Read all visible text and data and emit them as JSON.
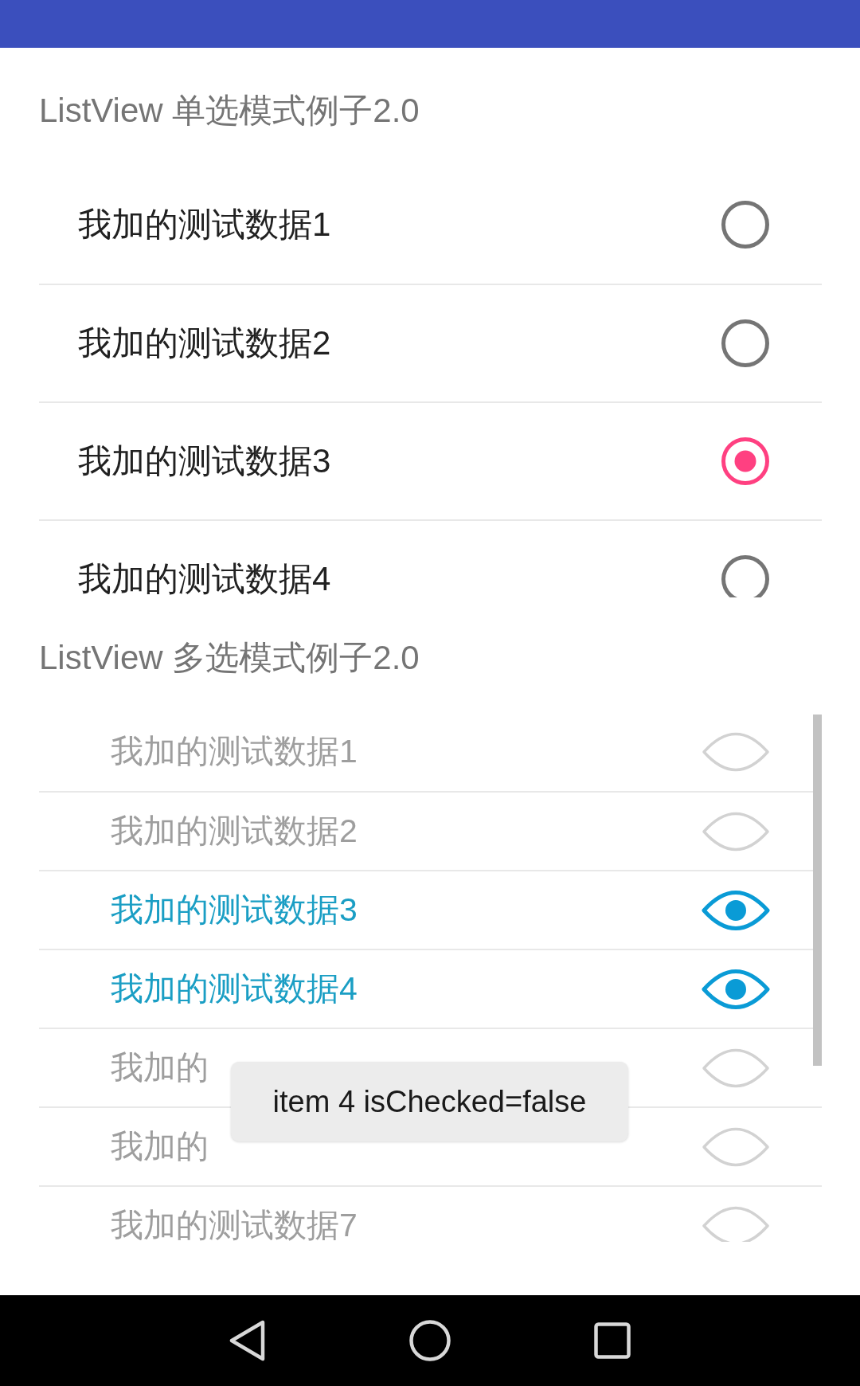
{
  "single_choice": {
    "title": "ListView 单选模式例子2.0",
    "items": [
      {
        "label": "我加的测试数据1",
        "selected": false
      },
      {
        "label": "我加的测试数据2",
        "selected": false
      },
      {
        "label": "我加的测试数据3",
        "selected": true
      },
      {
        "label": "我加的测试数据4",
        "selected": false
      }
    ]
  },
  "multi_choice": {
    "title": "ListView 多选模式例子2.0",
    "items": [
      {
        "label": "我加的测试数据1",
        "checked": false
      },
      {
        "label": "我加的测试数据2",
        "checked": false
      },
      {
        "label": "我加的测试数据3",
        "checked": true
      },
      {
        "label": "我加的测试数据4",
        "checked": true
      },
      {
        "label": "我加的",
        "checked": false
      },
      {
        "label": "我加的",
        "checked": false
      },
      {
        "label": "我加的测试数据7",
        "checked": false
      }
    ]
  },
  "toast": {
    "text": "item 4 isChecked=false"
  }
}
